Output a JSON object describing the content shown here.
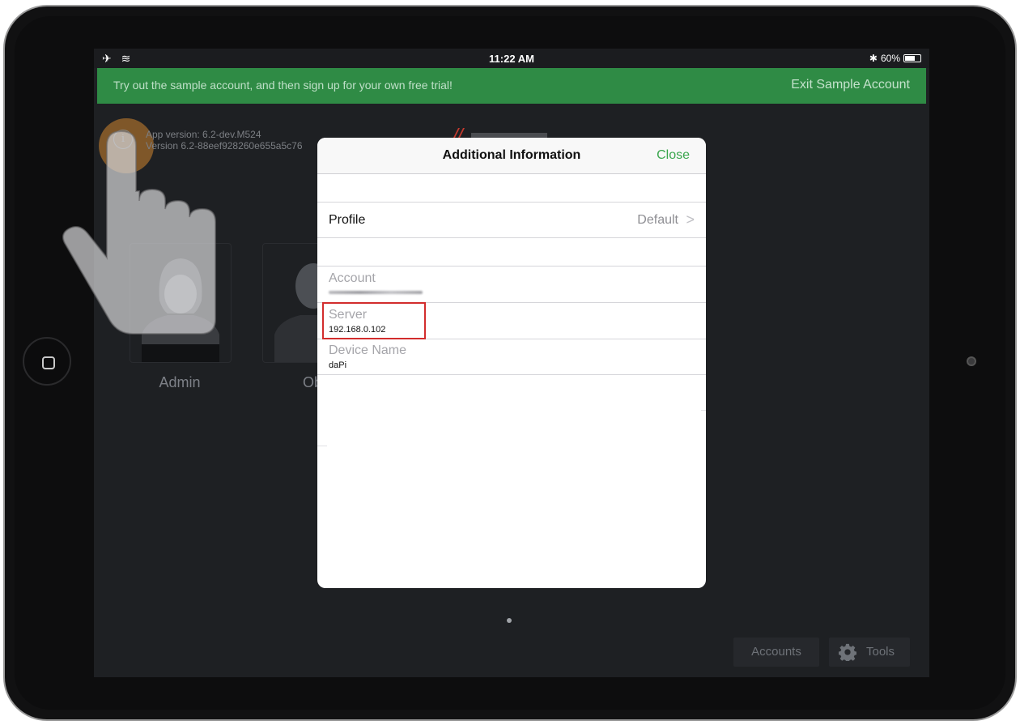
{
  "statusbar": {
    "time": "11:22 AM",
    "left_icons": "✈ ≋",
    "bluetooth": "✱",
    "battery_percent": "60%"
  },
  "banner": {
    "message": "Try out the sample account, and then sign up for your own free trial!",
    "exit_label": "Exit Sample Account"
  },
  "app_info": {
    "info_icon": "i",
    "app_version": "App version: 6.2-dev.M524",
    "build_version": "Version 6.2-88eef928260e655a5c76"
  },
  "users": [
    {
      "label": "Admin"
    },
    {
      "label": "Ob"
    }
  ],
  "footer": {
    "accounts_label": "Accounts",
    "tools_label": "Tools"
  },
  "modal": {
    "title": "Additional Information",
    "close_label": "Close",
    "profile_label": "Profile",
    "profile_value": "Default",
    "profile_chevron": ">",
    "account_label": "Account",
    "server_label": "Server",
    "server_value": "192.168.0.102",
    "device_name_label": "Device Name",
    "device_name_value": "daPi"
  },
  "colors": {
    "banner": "#2f8b45",
    "accent_green": "#3aa64d",
    "highlight_red": "#d22d2d",
    "screen_bg": "#1e2023"
  },
  "icons": [
    "airplane-icon",
    "wifi-icon",
    "bluetooth-icon",
    "battery-icon",
    "info-icon",
    "gear-icon",
    "chevron-right-icon",
    "home-button-icon",
    "camera-icon",
    "hand-pointer-icon"
  ]
}
